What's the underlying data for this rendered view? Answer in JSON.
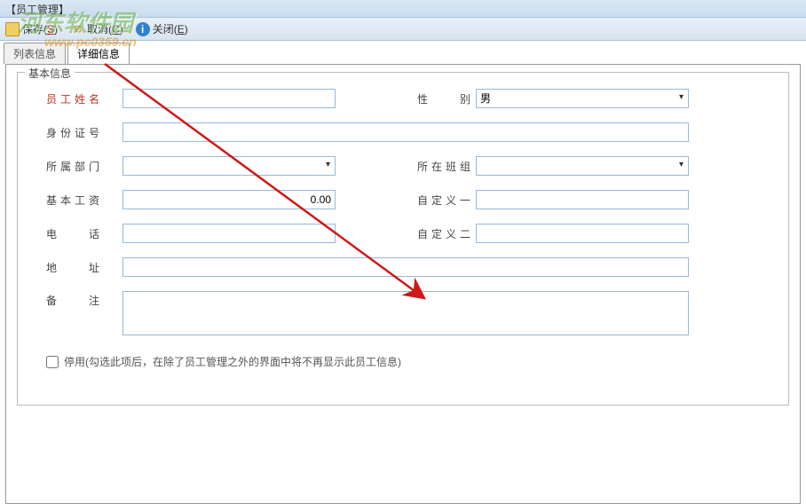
{
  "window": {
    "title": "【员工管理】"
  },
  "toolbar": {
    "save": "保存(S)",
    "cancel": "取消(C)",
    "close": "关闭(E)"
  },
  "tabs": {
    "list": "列表信息",
    "detail": "详细信息"
  },
  "fieldset": {
    "legend": "基本信息"
  },
  "form": {
    "name_label": "员工姓名",
    "name_value": "",
    "gender_label": "性    别",
    "gender_value": "男",
    "id_label": "身份证号",
    "id_value": "",
    "dept_label": "所属部门",
    "dept_value": "",
    "team_label": "所在班组",
    "team_value": "",
    "salary_label": "基本工资",
    "salary_value": "0.00",
    "custom1_label": "自定义一",
    "custom1_value": "",
    "phone_label": "电    话",
    "phone_value": "",
    "custom2_label": "自定义二",
    "custom2_value": "",
    "address_label": "地    址",
    "address_value": "",
    "remark_label": "备    注",
    "remark_value": "",
    "disable_label": "停用(勾选此项后，在除了员工管理之外的界面中将不再显示此员工信息)"
  },
  "watermark": {
    "line1": "河东软件园",
    "line2": "www.pc0359.cn"
  }
}
